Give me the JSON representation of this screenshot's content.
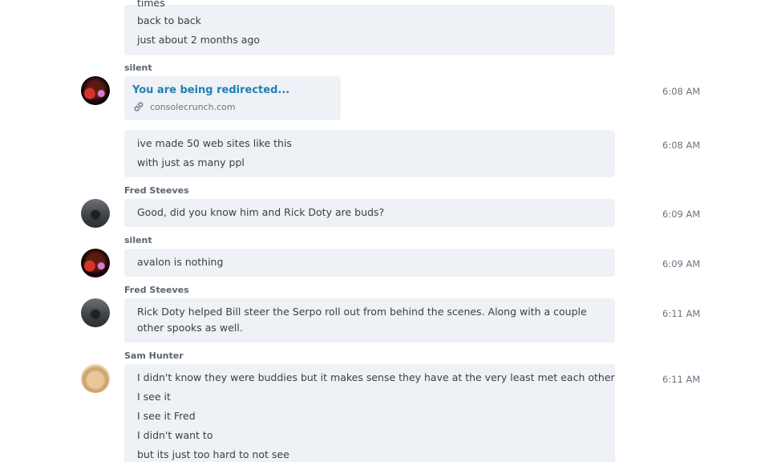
{
  "messages": {
    "first": {
      "partial_line": "times",
      "lines": [
        "back to back",
        "just about 2 months ago"
      ]
    },
    "silent_1": {
      "sender": "silent",
      "link_title": "You are being redirected...",
      "link_domain": "consolecrunch.com",
      "link_time": "6:08 AM",
      "lines": [
        "ive made 50 web sites like this",
        "with just as many ppl"
      ],
      "lines_time": "6:08 AM"
    },
    "fred_1": {
      "sender": "Fred Steeves",
      "text": "Good, did you know him and Rick Doty are buds?",
      "time": "6:09 AM"
    },
    "silent_2": {
      "sender": "silent",
      "text": "avalon is nothing",
      "time": "6:09 AM"
    },
    "fred_2": {
      "sender": "Fred Steeves",
      "text": "Rick Doty helped Bill steer the Serpo roll out from behind the scenes. Along with a couple other spooks as well.",
      "time": "6:11 AM"
    },
    "sam_1": {
      "sender": "Sam Hunter",
      "lines": [
        "I didn't know they were buddies but it makes sense they have at the very least met each other",
        "I see it",
        "I see it Fred",
        "I didn't want to",
        "but its just too hard to not see"
      ],
      "time": "6:11 AM"
    }
  },
  "icons": {
    "link": "link-icon"
  },
  "colors": {
    "bubble": "#eef1f5",
    "link": "#1f7fb5",
    "text": "#3a3f47",
    "muted": "#6b7480"
  }
}
